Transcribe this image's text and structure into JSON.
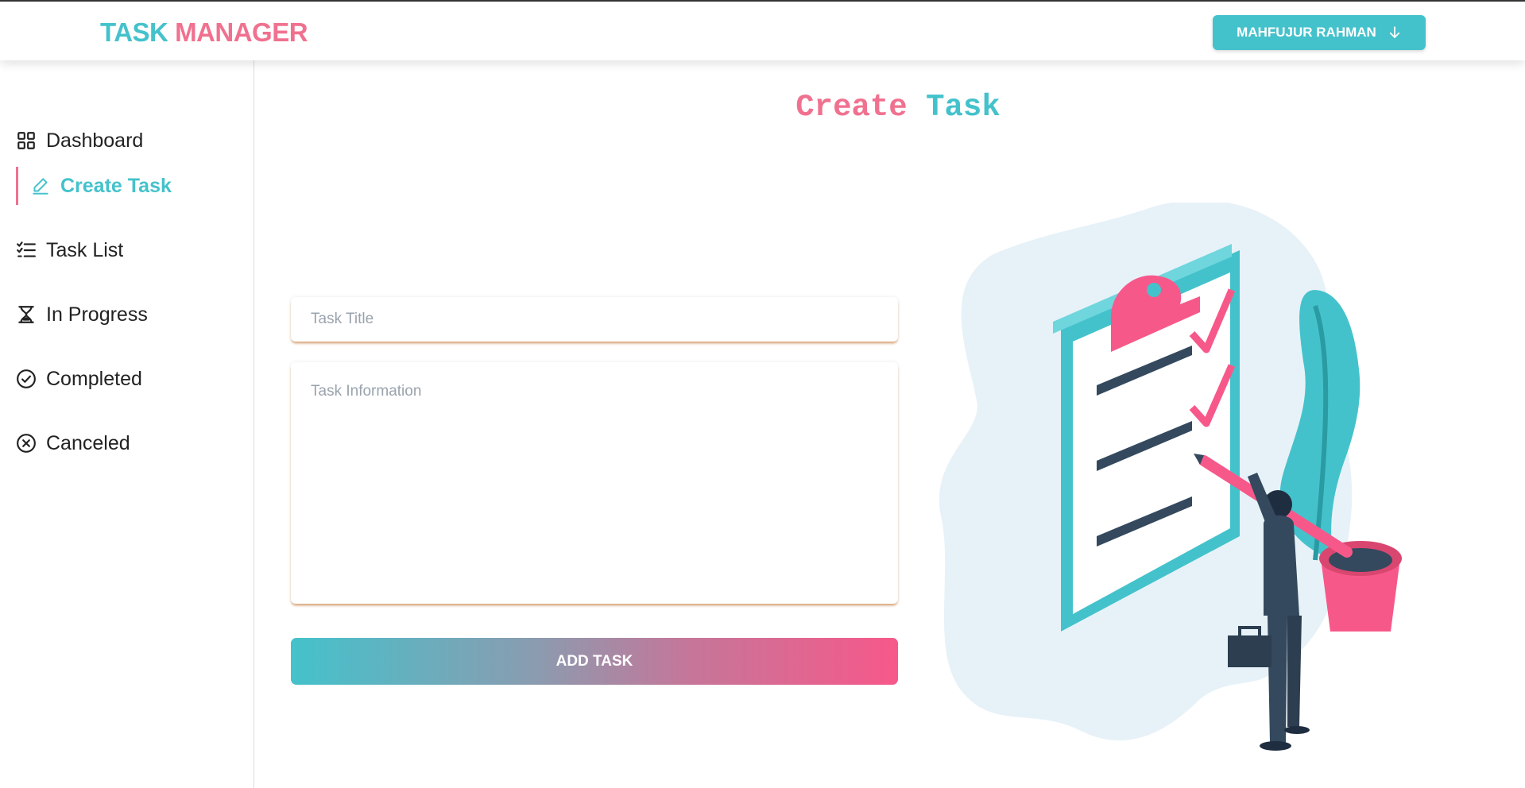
{
  "header": {
    "brand_part1": "TASK",
    "brand_part2": "MANAGER",
    "user_button_label": "MAHFUJUR RAHMAN",
    "user_button_icon": "arrow-down-icon"
  },
  "sidebar": {
    "items": [
      {
        "label": "Dashboard",
        "icon": "grid-icon",
        "active": false
      },
      {
        "label": "Create Task",
        "icon": "pencil-icon",
        "active": true
      },
      {
        "label": "Task List",
        "icon": "checklist-icon",
        "active": false
      },
      {
        "label": "In Progress",
        "icon": "hourglass-icon",
        "active": false
      },
      {
        "label": "Completed",
        "icon": "check-circle-icon",
        "active": false
      },
      {
        "label": "Canceled",
        "icon": "x-circle-icon",
        "active": false
      }
    ]
  },
  "main": {
    "title_part1": "Create",
    "title_part2": "Task",
    "task_title_placeholder": "Task Title",
    "task_info_placeholder": "Task Information",
    "add_button_label": "ADD TASK",
    "illustration": "clipboard-checklist-businessman-illustration"
  },
  "colors": {
    "teal": "#44c2cb",
    "pink": "#f0718f",
    "hot_pink": "#f7588a",
    "navy": "#34495e"
  }
}
